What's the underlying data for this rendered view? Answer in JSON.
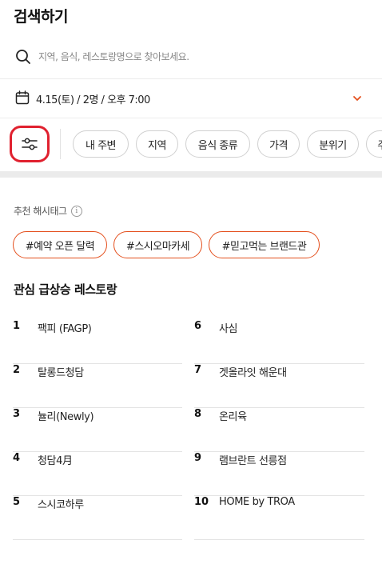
{
  "header": {
    "title": "검색하기"
  },
  "search": {
    "placeholder": "지역, 음식, 레스토랑명으로 찾아보세요.",
    "icon": "search-icon"
  },
  "datetime": {
    "text": "4.15(토) / 2명 / 오후 7:00",
    "icon": "calendar-icon",
    "chevron": "chevron-down-icon"
  },
  "filters": {
    "settings_icon": "sliders-icon",
    "chips": [
      "내 주변",
      "지역",
      "음식 종류",
      "가격",
      "분위기",
      "주"
    ]
  },
  "hashtags": {
    "label": "추천 해시태그",
    "info": "i",
    "tags": [
      "#예약 오픈 달력",
      "#스시오마카세",
      "#믿고먹는 브랜드관"
    ]
  },
  "trending": {
    "title": "관심 급상승 레스토랑",
    "items": [
      {
        "rank": "1",
        "name": "팩피 (FAGP)"
      },
      {
        "rank": "2",
        "name": "탈롱드청담"
      },
      {
        "rank": "3",
        "name": "뉼리(Newly)"
      },
      {
        "rank": "4",
        "name": "청담4月"
      },
      {
        "rank": "5",
        "name": "스시코하루"
      },
      {
        "rank": "6",
        "name": "사심"
      },
      {
        "rank": "7",
        "name": "겟올라잇 해운대"
      },
      {
        "rank": "8",
        "name": "온리육"
      },
      {
        "rank": "9",
        "name": "램브란트 선릉점"
      },
      {
        "rank": "10",
        "name": "HOME by TROA"
      }
    ]
  },
  "colors": {
    "accent": "#e4501e",
    "highlight": "#e0212f"
  }
}
